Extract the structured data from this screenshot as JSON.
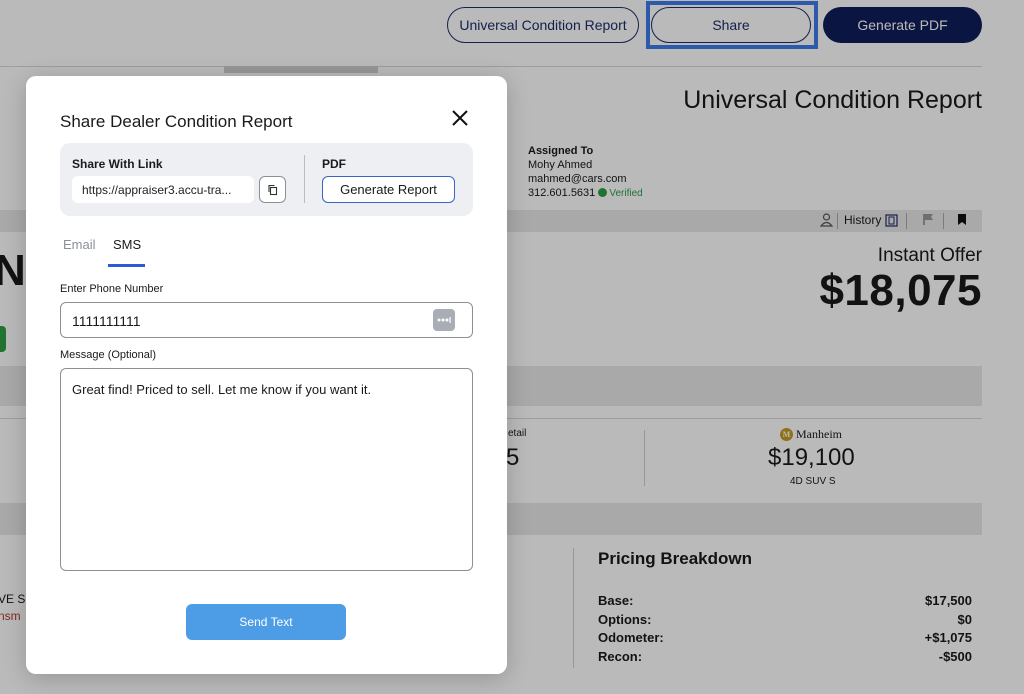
{
  "header": {
    "ucr_button": "Universal Condition Report",
    "share_button": "Share",
    "pdf_button": "Generate PDF"
  },
  "report": {
    "title": "Universal Condition Report",
    "assigned_label": "Assigned To",
    "assigned_name": "Mohy Ahmed",
    "assigned_email": "mahmed@cars.com",
    "assigned_phone": "312.601.5631",
    "verified_label": "Verified",
    "history_label": "History",
    "instant_offer_label": "Instant Offer",
    "instant_offer_value": "$18,075",
    "partial_N": "N",
    "partial_retail_label": "etail",
    "partial_retail_value": "5",
    "manheim_label": "Manheim",
    "manheim_value": "$19,100",
    "manheim_sub": "4D SUV S",
    "partial_vs": "VE S",
    "partial_nsm": "nsm",
    "pricing": {
      "title": "Pricing Breakdown",
      "rows": [
        {
          "label": "Base:",
          "value": "$17,500"
        },
        {
          "label": "Options:",
          "value": "$0"
        },
        {
          "label": "Odometer:",
          "value": "+$1,075"
        },
        {
          "label": "Recon:",
          "value": "-$500"
        }
      ]
    }
  },
  "modal": {
    "title": "Share Dealer Condition Report",
    "share_link_label": "Share With Link",
    "share_link_value": "https://appraiser3.accu-tra...",
    "pdf_label": "PDF",
    "generate_report_button": "Generate Report",
    "tabs": [
      "Email",
      "SMS"
    ],
    "active_tab": "SMS",
    "phone_label": "Enter Phone Number",
    "phone_value": "1111111111",
    "message_label": "Message (Optional)",
    "message_value": "Great find! Priced to sell. Let me know if you want it.",
    "send_button": "Send Text"
  },
  "colors": {
    "navy": "#0f1e5a",
    "highlight": "#3d7be8",
    "send": "#4d9de6",
    "tab_accent": "#2b5bd7",
    "verified": "#2f9e44"
  }
}
